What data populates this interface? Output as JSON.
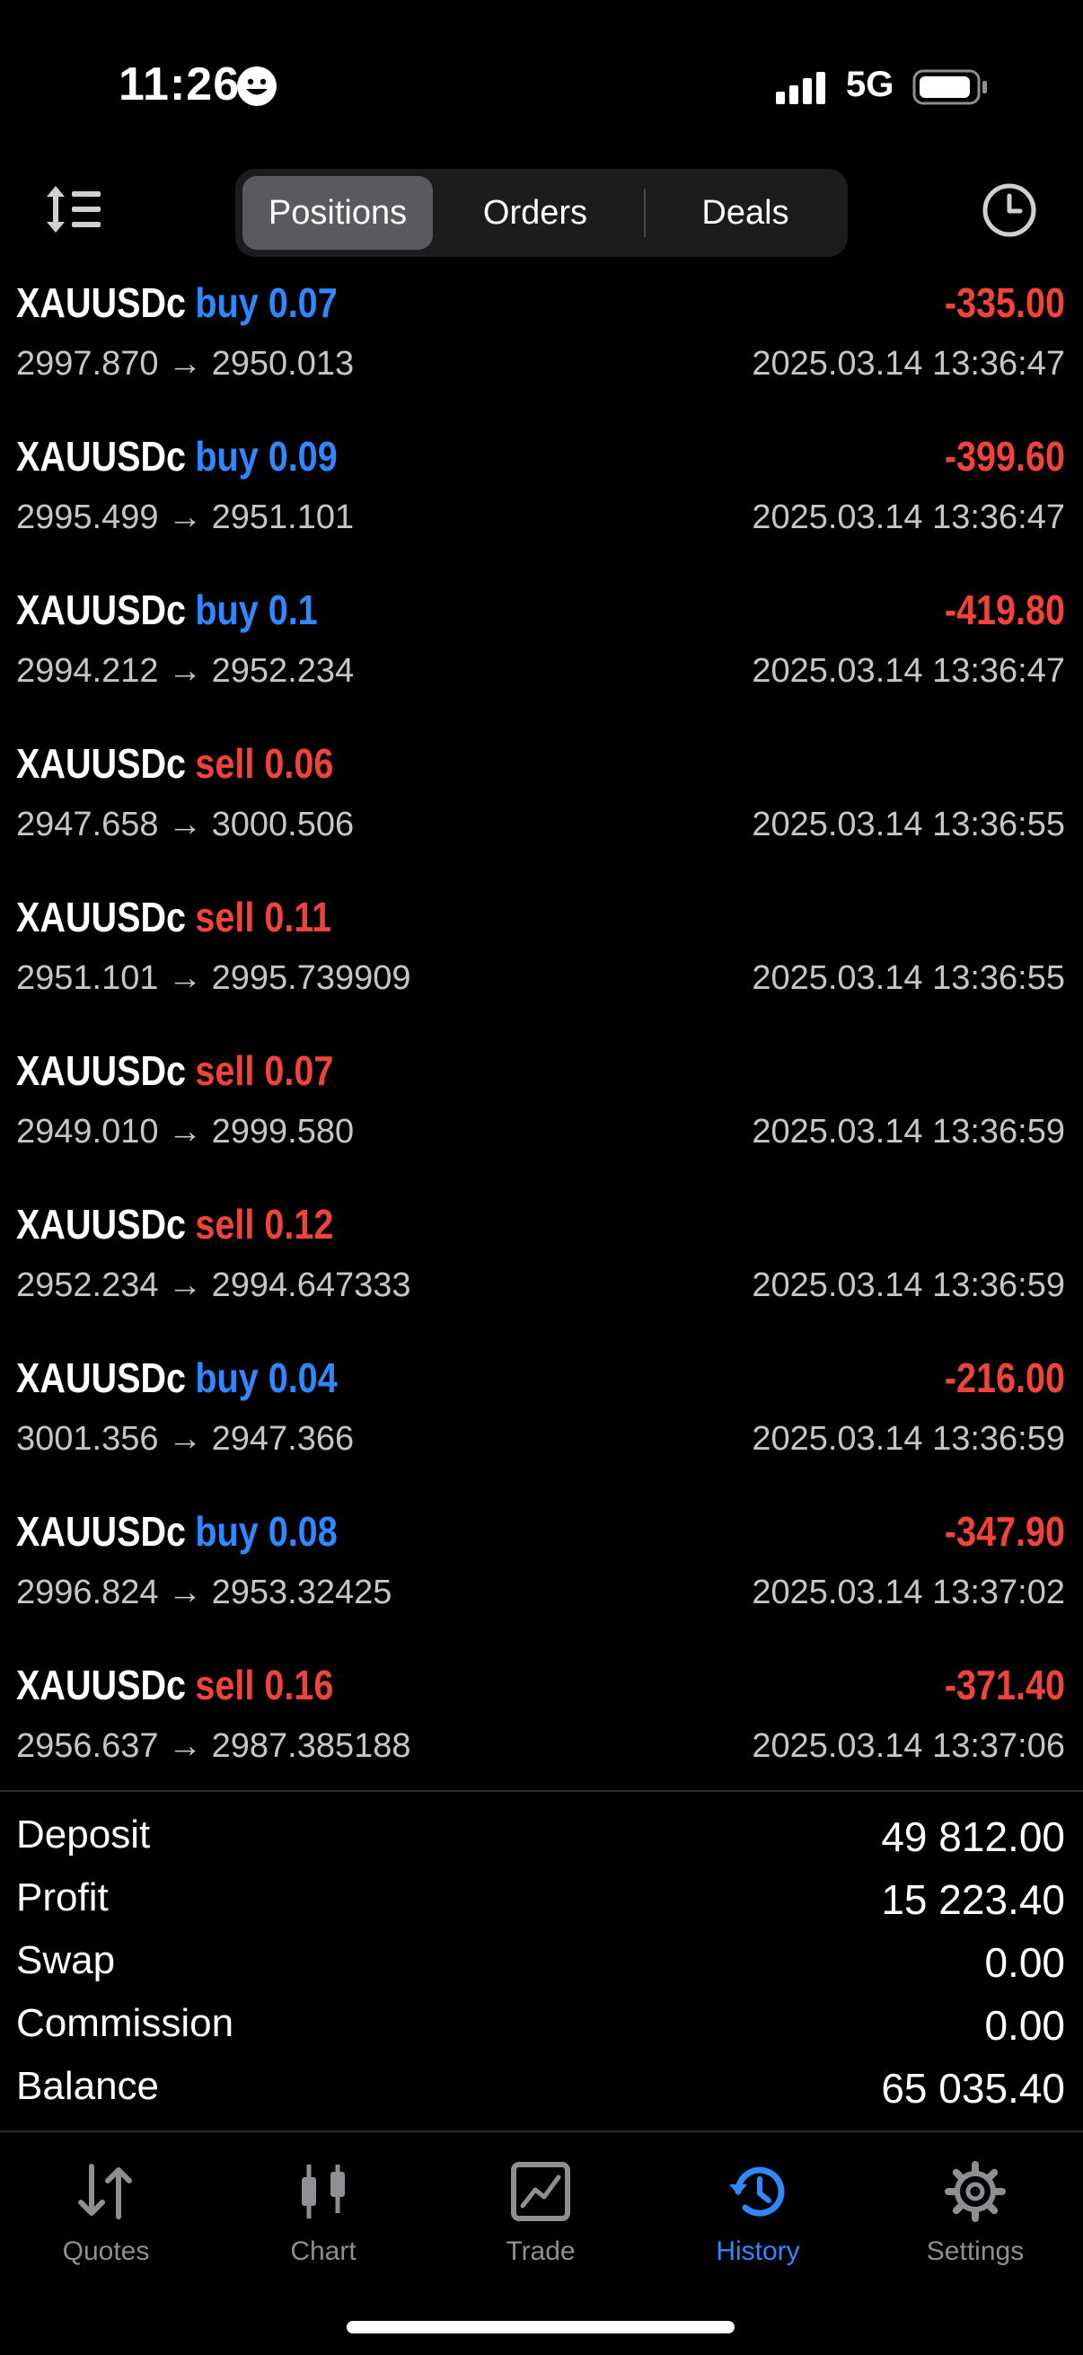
{
  "status_bar": {
    "time": "11:26",
    "network": "5G"
  },
  "header": {
    "tabs": [
      {
        "label": "Positions",
        "active": true
      },
      {
        "label": "Orders",
        "active": false
      },
      {
        "label": "Deals",
        "active": false
      }
    ],
    "sort_icon": "sort-icon",
    "clock_icon": "clock-icon"
  },
  "rows": [
    {
      "symbol": "XAUUSDc",
      "side": "buy 0.07",
      "type": "buy",
      "profit": "-335.00",
      "prices": "2997.870 → 2950.013",
      "time": "2025.03.14 13:36:47"
    },
    {
      "symbol": "XAUUSDc",
      "side": "buy 0.09",
      "type": "buy",
      "profit": "-399.60",
      "prices": "2995.499 → 2951.101",
      "time": "2025.03.14 13:36:47"
    },
    {
      "symbol": "XAUUSDc",
      "side": "buy 0.1",
      "type": "buy",
      "profit": "-419.80",
      "prices": "2994.212 → 2952.234",
      "time": "2025.03.14 13:36:47"
    },
    {
      "symbol": "XAUUSDc",
      "side": "sell 0.06",
      "type": "sell",
      "profit": "",
      "prices": "2947.658 → 3000.506",
      "time": "2025.03.14 13:36:55"
    },
    {
      "symbol": "XAUUSDc",
      "side": "sell 0.11",
      "type": "sell",
      "profit": "",
      "prices": "2951.101 → 2995.739909",
      "time": "2025.03.14 13:36:55"
    },
    {
      "symbol": "XAUUSDc",
      "side": "sell 0.07",
      "type": "sell",
      "profit": "",
      "prices": "2949.010 → 2999.580",
      "time": "2025.03.14 13:36:59"
    },
    {
      "symbol": "XAUUSDc",
      "side": "sell 0.12",
      "type": "sell",
      "profit": "",
      "prices": "2952.234 → 2994.647333",
      "time": "2025.03.14 13:36:59"
    },
    {
      "symbol": "XAUUSDc",
      "side": "buy 0.04",
      "type": "buy",
      "profit": "-216.00",
      "prices": "3001.356 → 2947.366",
      "time": "2025.03.14 13:36:59"
    },
    {
      "symbol": "XAUUSDc",
      "side": "buy 0.08",
      "type": "buy",
      "profit": "-347.90",
      "prices": "2996.824 → 2953.32425",
      "time": "2025.03.14 13:37:02"
    },
    {
      "symbol": "XAUUSDc",
      "side": "sell 0.16",
      "type": "sell",
      "profit": "-371.40",
      "prices": "2956.637 → 2987.385188",
      "time": "2025.03.14 13:37:06"
    }
  ],
  "summary": [
    {
      "label": "Deposit",
      "value": "49 812.00"
    },
    {
      "label": "Profit",
      "value": "15 223.40"
    },
    {
      "label": "Swap",
      "value": "0.00"
    },
    {
      "label": "Commission",
      "value": "0.00"
    },
    {
      "label": "Balance",
      "value": "65 035.40"
    }
  ],
  "tabbar": [
    {
      "label": "Quotes",
      "icon": "quotes-icon",
      "active": false
    },
    {
      "label": "Chart",
      "icon": "chart-icon",
      "active": false
    },
    {
      "label": "Trade",
      "icon": "trade-icon",
      "active": false
    },
    {
      "label": "History",
      "icon": "history-icon",
      "active": true
    },
    {
      "label": "Settings",
      "icon": "settings-icon",
      "active": false
    }
  ],
  "colors": {
    "buy": "#2f88ff",
    "sell": "#f2433b",
    "loss": "#f2433b",
    "accent": "#2f88ff",
    "background": "#000000"
  }
}
